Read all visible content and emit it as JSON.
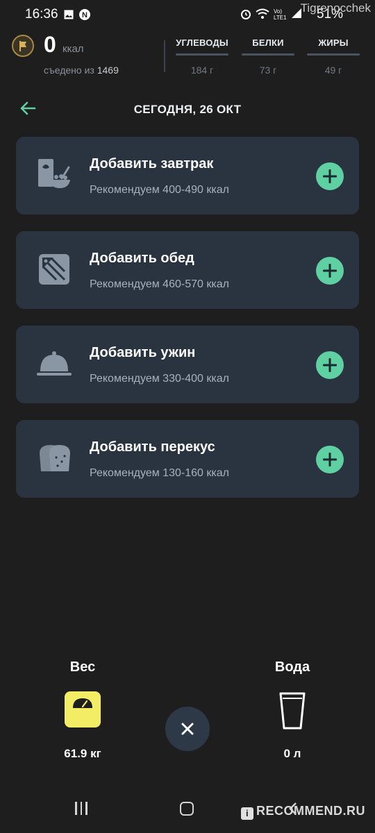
{
  "status_bar": {
    "time": "16:36",
    "right_text": "Vo) LTE1 .ıl 51%",
    "watermark": "Tigrenocchek",
    "icons": [
      "image-icon",
      "n-app-icon",
      "alarm-icon",
      "wifi-icon",
      "signal-icon",
      "battery-icon"
    ]
  },
  "summary": {
    "kcal_value": "0",
    "kcal_unit": "ккал",
    "eaten_prefix": "съедено из",
    "eaten_total": "1469",
    "macros": [
      {
        "label": "УГЛЕВОДЫ",
        "value": "184 г"
      },
      {
        "label": "БЕЛКИ",
        "value": "73 г"
      },
      {
        "label": "ЖИРЫ",
        "value": "49 г"
      }
    ]
  },
  "date_title": "СЕГОДНЯ, 26 ОКТ",
  "meals": [
    {
      "title": "Добавить завтрак",
      "subtitle": "Рекомендуем 400-490 ккал",
      "icon": "breakfast-bowl-icon"
    },
    {
      "title": "Добавить обед",
      "subtitle": "Рекомендуем 460-570 ккал",
      "icon": "lunch-pizza-icon"
    },
    {
      "title": "Добавить ужин",
      "subtitle": "Рекомендуем 330-400 ккал",
      "icon": "dinner-cloche-icon"
    },
    {
      "title": "Добавить перекус",
      "subtitle": "Рекомендуем 130-160 ккал",
      "icon": "snack-bread-icon"
    }
  ],
  "trackers": {
    "weight": {
      "title": "Вес",
      "value": "61.9 кг"
    },
    "water": {
      "title": "Вода",
      "value": "0 л"
    }
  },
  "bottom_watermark": "RECOMMEND.RU",
  "colors": {
    "background": "#1e1e1f",
    "card": "#2a3441",
    "accent_green": "#5ed0a2",
    "scale_yellow": "#f3ec65",
    "badge_gold": "#a88b43"
  }
}
